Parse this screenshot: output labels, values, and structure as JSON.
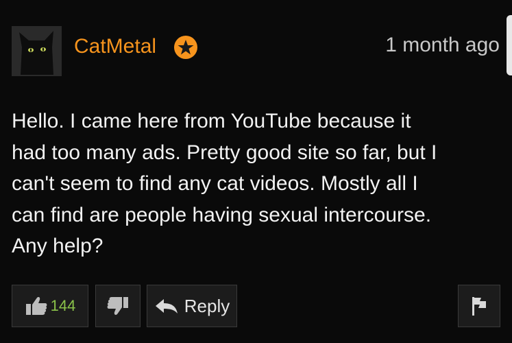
{
  "comment": {
    "username": "CatMetal",
    "timestamp": "1 month ago",
    "body": "Hello.  I came here from YouTube because it\nhad too many ads.  Pretty good site so far, but I\ncan't seem to find any cat videos.  Mostly all I\ncan find are people having sexual intercourse.\nAny help?",
    "likes": "144",
    "reply_label": "Reply"
  },
  "icons": {
    "avatar": "black-cat-avatar",
    "badge": "star-badge-icon",
    "like": "thumbs-up-icon",
    "dislike": "thumbs-down-icon",
    "reply": "reply-arrow-icon",
    "flag": "flag-icon"
  },
  "colors": {
    "background": "#0a0a0a",
    "username": "#f7941d",
    "badge": "#f7941d",
    "like_count": "#8bc34a",
    "text": "#f2f2f2"
  }
}
